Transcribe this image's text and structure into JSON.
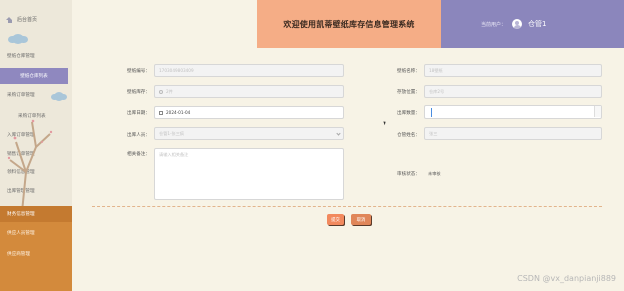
{
  "sidebar": {
    "home_label": "后台首页",
    "items": [
      {
        "label": "壁纸仓库管理"
      },
      {
        "label": "壁纸仓库列表"
      },
      {
        "label": "采购订单管理"
      },
      {
        "label": "采购订单列表"
      },
      {
        "label": "入库订单管理"
      },
      {
        "label": "销售订单管理"
      },
      {
        "label": "领料信息管理"
      },
      {
        "label": "出库管理管理"
      },
      {
        "label": "财务信息管理"
      },
      {
        "label": "供应人员管理"
      },
      {
        "label": "供应商管理"
      }
    ]
  },
  "header": {
    "title": "欢迎使用凯蒂壁纸库存信息管理系统",
    "user_label": "当前用户：",
    "user_name": "仓管1"
  },
  "form": {
    "wallpaper_no": {
      "label": "壁纸编号：",
      "placeholder": "1703049803409"
    },
    "wallpaper_name": {
      "label": "壁纸名称：",
      "placeholder": "18壁纸"
    },
    "wallpaper_warehouse": {
      "label": "壁纸库存：",
      "value": "2件"
    },
    "location": {
      "label": "存放位置：",
      "placeholder": "仓库2号"
    },
    "outbound_date": {
      "label": "出库日期：",
      "value": "2024-01-04"
    },
    "outbound_qty": {
      "label": "出库数量：",
      "value": ""
    },
    "handler": {
      "label": "出库人员：",
      "value": "仓管1-张三疯"
    },
    "handler_name": {
      "label": "仓管姓名：",
      "placeholder": "张三"
    },
    "remarks": {
      "label": "相关备注：",
      "placeholder": "请输入相关备注"
    },
    "review_status": {
      "label": "审核状态：",
      "value": "未审核"
    }
  },
  "actions": {
    "submit_label": "提交",
    "cancel_label": "取消"
  },
  "watermark": "CSDN @vx_danpianji889",
  "colors": {
    "header_title_bg": "#f5ad86",
    "header_user_bg": "#8b86bc",
    "sidebar_active_bg": "#8f88bf",
    "sidebar_lower_bg": "#d38a3c",
    "page_bg": "#f7f3e6"
  }
}
